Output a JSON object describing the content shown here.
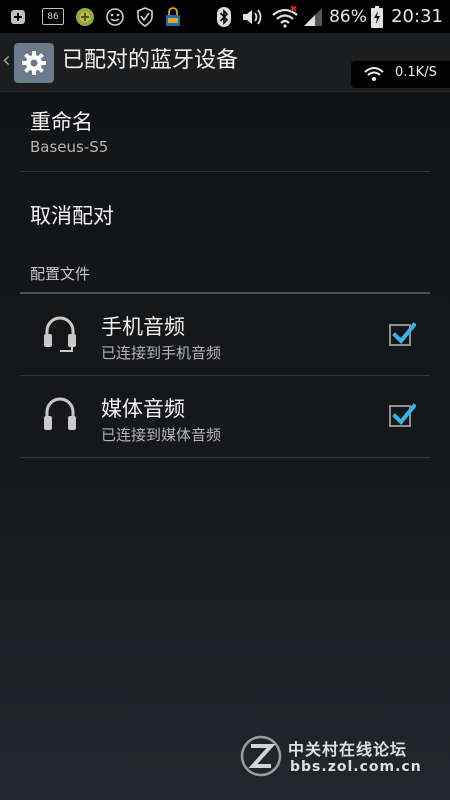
{
  "status_bar": {
    "icons": [
      "plus-notification-icon",
      "badge-86-icon",
      "game-icon",
      "face-icon",
      "shield-icon",
      "lock-icon",
      "bluetooth-icon",
      "volume-icon",
      "wifi-icon",
      "signal-icon",
      "battery-icon"
    ],
    "notification_badge": "86",
    "battery_percent": "86%",
    "time": "20:31"
  },
  "action_bar": {
    "title": "已配对的蓝牙设备",
    "network_speed": "0.1K/S"
  },
  "settings": {
    "rename": {
      "label": "重命名",
      "device_name": "Baseus-S5"
    },
    "unpair": {
      "label": "取消配对"
    },
    "profiles_header": "配置文件",
    "profiles": [
      {
        "title": "手机音频",
        "status": "已连接到手机音频",
        "checked": true,
        "icon": "headset-mic-icon"
      },
      {
        "title": "媒体音频",
        "status": "已连接到媒体音频",
        "checked": true,
        "icon": "headphones-icon"
      }
    ]
  },
  "watermark": {
    "title": "中关村在线论坛",
    "url": "bbs.zol.com.cn"
  },
  "colors": {
    "accent": "#33b5e5",
    "background": "#15171a",
    "divider": "#34363a"
  }
}
